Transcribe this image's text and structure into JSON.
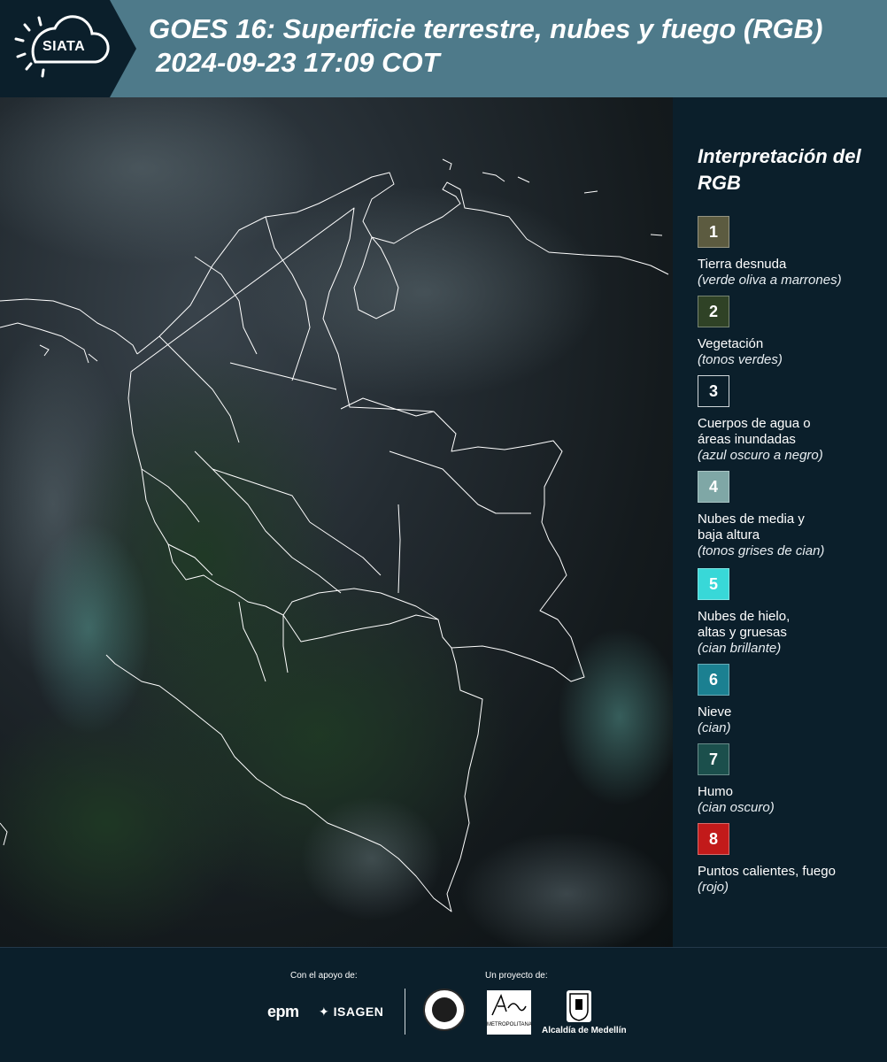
{
  "header": {
    "logo": "SIATA",
    "title_line1": "GOES 16: Superficie terrestre, nubes y fuego (RGB)",
    "title_line2": "2024-09-23 17:09 COT"
  },
  "legend": {
    "title": "Interpretación del RGB",
    "items": [
      {
        "num": "1",
        "name": "Tierra desnuda",
        "desc": "(verde oliva a marrones)",
        "color": "#5c5b40"
      },
      {
        "num": "2",
        "name": "Vegetación",
        "desc": "(tonos verdes)",
        "color": "#2f4226"
      },
      {
        "num": "3",
        "name": "Cuerpos de agua o áreas inundadas",
        "desc": "(azul oscuro a negro)",
        "color": "#0b1f2b"
      },
      {
        "num": "4",
        "name": "Nubes de media y baja altura",
        "desc": "(tonos grises de cian)",
        "color": "#7fa7a6"
      },
      {
        "num": "5",
        "name": "Nubes de hielo, altas y gruesas",
        "desc": "(cian brillante)",
        "color": "#38d8d8"
      },
      {
        "num": "6",
        "name": "Nieve",
        "desc": "(cian)",
        "color": "#1b8091"
      },
      {
        "num": "7",
        "name": "Humo",
        "desc": "(cian oscuro)",
        "color": "#1b4f4c"
      },
      {
        "num": "8",
        "name": "Puntos calientes, fuego",
        "desc": "(rojo)",
        "color": "#c21a1a"
      }
    ]
  },
  "footer": {
    "support_label": "Con el apoyo de:",
    "project_label": "Un proyecto de:",
    "epm": "epm",
    "isagen": "ISAGEN",
    "area_text": "METROPOLITANA",
    "medellin": "Alcaldía de Medellín"
  }
}
